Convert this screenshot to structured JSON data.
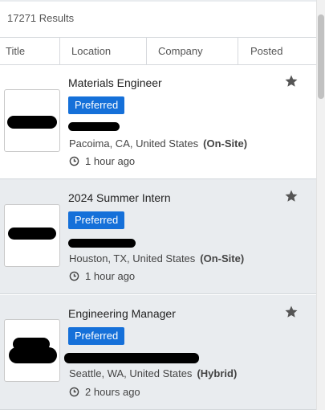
{
  "results": {
    "count": "17271",
    "label": "Results"
  },
  "columns": [
    "Title",
    "Location",
    "Company",
    "Posted"
  ],
  "jobs": [
    {
      "title": "Materials Engineer",
      "badge": "Preferred",
      "location": "Pacoima, CA, United States",
      "work_type": "(On-Site)",
      "posted": "1 hour ago"
    },
    {
      "title": "2024 Summer Intern",
      "badge": "Preferred",
      "location": "Houston, TX, United States",
      "work_type": "(On-Site)",
      "posted": "1 hour ago"
    },
    {
      "title": "Engineering Manager",
      "badge": "Preferred",
      "location": "Seattle, WA, United States",
      "work_type": "(Hybrid)",
      "posted": "2 hours ago"
    }
  ],
  "colors": {
    "badge": "#1570d9",
    "alt_row": "#e9ecef",
    "star": "#555555"
  },
  "icons": {
    "favorite": "star-icon",
    "posted": "clock-icon"
  }
}
